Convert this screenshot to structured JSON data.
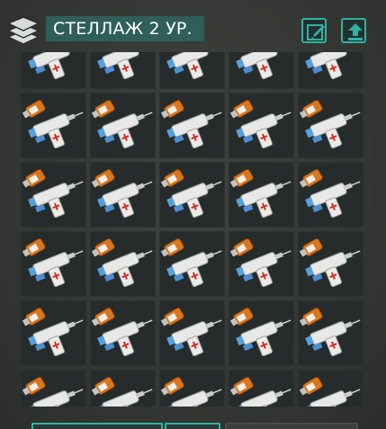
{
  "header": {
    "title": "СТЕЛЛАЖ 2 УР.",
    "icon": "stack-icon",
    "buttons": [
      {
        "icon": "edit-brush-icon"
      },
      {
        "icon": "upload-arrow-icon"
      }
    ]
  },
  "storage": {
    "columns": 5,
    "slot_count": 30,
    "item_icon": "medical-syringe-icon"
  },
  "colors": {
    "accent": "#2fb3a3",
    "title_bg": "#2f5e5b",
    "slot_bg": "#262b2b",
    "background": "#3a3d39"
  }
}
